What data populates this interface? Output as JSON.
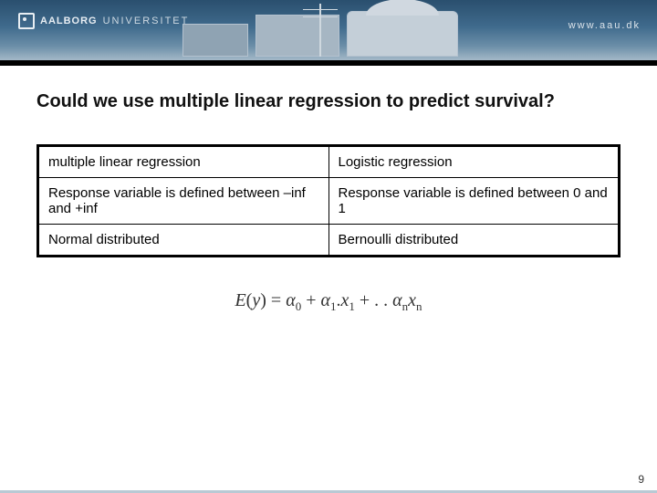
{
  "header": {
    "logo_bold": "AALBORG",
    "logo_light": "UNIVERSITET",
    "url": "www.aau.dk"
  },
  "title": "Could we use multiple linear regression to predict survival?",
  "table": {
    "rows": [
      {
        "left": "multiple linear regression",
        "right": "Logistic regression"
      },
      {
        "left": "Response variable is defined between –inf and +inf",
        "right": "Response variable is defined between 0 and 1"
      },
      {
        "left": "Normal distributed",
        "right": "Bernoulli distributed"
      }
    ]
  },
  "formula_parts": {
    "lhs": "E",
    "y": "y",
    "eq": " = ",
    "a": "α",
    "x": "x",
    "plus": " + ",
    "dots": " + . . ",
    "open": "(",
    "close": ")"
  },
  "page_number": "9"
}
